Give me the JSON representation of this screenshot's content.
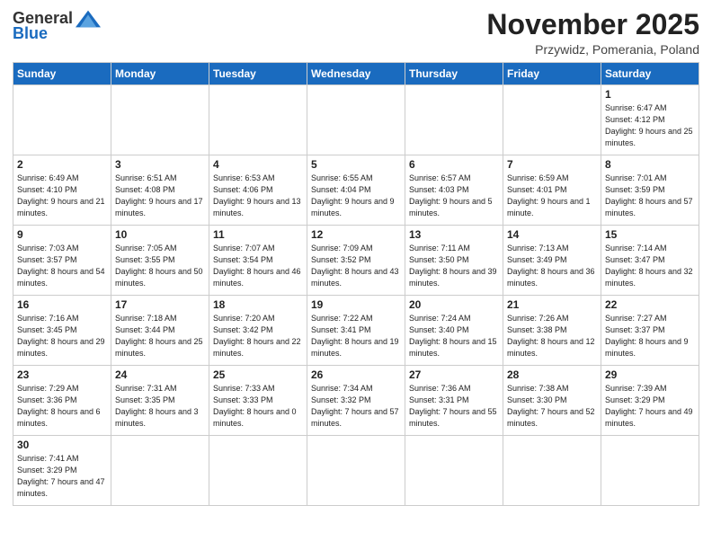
{
  "header": {
    "logo_general": "General",
    "logo_blue": "Blue",
    "month_title": "November 2025",
    "location": "Przywidz, Pomerania, Poland"
  },
  "weekdays": [
    "Sunday",
    "Monday",
    "Tuesday",
    "Wednesday",
    "Thursday",
    "Friday",
    "Saturday"
  ],
  "weeks": [
    [
      {
        "day": "",
        "info": ""
      },
      {
        "day": "",
        "info": ""
      },
      {
        "day": "",
        "info": ""
      },
      {
        "day": "",
        "info": ""
      },
      {
        "day": "",
        "info": ""
      },
      {
        "day": "",
        "info": ""
      },
      {
        "day": "1",
        "info": "Sunrise: 6:47 AM\nSunset: 4:12 PM\nDaylight: 9 hours\nand 25 minutes."
      }
    ],
    [
      {
        "day": "2",
        "info": "Sunrise: 6:49 AM\nSunset: 4:10 PM\nDaylight: 9 hours\nand 21 minutes."
      },
      {
        "day": "3",
        "info": "Sunrise: 6:51 AM\nSunset: 4:08 PM\nDaylight: 9 hours\nand 17 minutes."
      },
      {
        "day": "4",
        "info": "Sunrise: 6:53 AM\nSunset: 4:06 PM\nDaylight: 9 hours\nand 13 minutes."
      },
      {
        "day": "5",
        "info": "Sunrise: 6:55 AM\nSunset: 4:04 PM\nDaylight: 9 hours\nand 9 minutes."
      },
      {
        "day": "6",
        "info": "Sunrise: 6:57 AM\nSunset: 4:03 PM\nDaylight: 9 hours\nand 5 minutes."
      },
      {
        "day": "7",
        "info": "Sunrise: 6:59 AM\nSunset: 4:01 PM\nDaylight: 9 hours\nand 1 minute."
      },
      {
        "day": "8",
        "info": "Sunrise: 7:01 AM\nSunset: 3:59 PM\nDaylight: 8 hours\nand 57 minutes."
      }
    ],
    [
      {
        "day": "9",
        "info": "Sunrise: 7:03 AM\nSunset: 3:57 PM\nDaylight: 8 hours\nand 54 minutes."
      },
      {
        "day": "10",
        "info": "Sunrise: 7:05 AM\nSunset: 3:55 PM\nDaylight: 8 hours\nand 50 minutes."
      },
      {
        "day": "11",
        "info": "Sunrise: 7:07 AM\nSunset: 3:54 PM\nDaylight: 8 hours\nand 46 minutes."
      },
      {
        "day": "12",
        "info": "Sunrise: 7:09 AM\nSunset: 3:52 PM\nDaylight: 8 hours\nand 43 minutes."
      },
      {
        "day": "13",
        "info": "Sunrise: 7:11 AM\nSunset: 3:50 PM\nDaylight: 8 hours\nand 39 minutes."
      },
      {
        "day": "14",
        "info": "Sunrise: 7:13 AM\nSunset: 3:49 PM\nDaylight: 8 hours\nand 36 minutes."
      },
      {
        "day": "15",
        "info": "Sunrise: 7:14 AM\nSunset: 3:47 PM\nDaylight: 8 hours\nand 32 minutes."
      }
    ],
    [
      {
        "day": "16",
        "info": "Sunrise: 7:16 AM\nSunset: 3:45 PM\nDaylight: 8 hours\nand 29 minutes."
      },
      {
        "day": "17",
        "info": "Sunrise: 7:18 AM\nSunset: 3:44 PM\nDaylight: 8 hours\nand 25 minutes."
      },
      {
        "day": "18",
        "info": "Sunrise: 7:20 AM\nSunset: 3:42 PM\nDaylight: 8 hours\nand 22 minutes."
      },
      {
        "day": "19",
        "info": "Sunrise: 7:22 AM\nSunset: 3:41 PM\nDaylight: 8 hours\nand 19 minutes."
      },
      {
        "day": "20",
        "info": "Sunrise: 7:24 AM\nSunset: 3:40 PM\nDaylight: 8 hours\nand 15 minutes."
      },
      {
        "day": "21",
        "info": "Sunrise: 7:26 AM\nSunset: 3:38 PM\nDaylight: 8 hours\nand 12 minutes."
      },
      {
        "day": "22",
        "info": "Sunrise: 7:27 AM\nSunset: 3:37 PM\nDaylight: 8 hours\nand 9 minutes."
      }
    ],
    [
      {
        "day": "23",
        "info": "Sunrise: 7:29 AM\nSunset: 3:36 PM\nDaylight: 8 hours\nand 6 minutes."
      },
      {
        "day": "24",
        "info": "Sunrise: 7:31 AM\nSunset: 3:35 PM\nDaylight: 8 hours\nand 3 minutes."
      },
      {
        "day": "25",
        "info": "Sunrise: 7:33 AM\nSunset: 3:33 PM\nDaylight: 8 hours\nand 0 minutes."
      },
      {
        "day": "26",
        "info": "Sunrise: 7:34 AM\nSunset: 3:32 PM\nDaylight: 7 hours\nand 57 minutes."
      },
      {
        "day": "27",
        "info": "Sunrise: 7:36 AM\nSunset: 3:31 PM\nDaylight: 7 hours\nand 55 minutes."
      },
      {
        "day": "28",
        "info": "Sunrise: 7:38 AM\nSunset: 3:30 PM\nDaylight: 7 hours\nand 52 minutes."
      },
      {
        "day": "29",
        "info": "Sunrise: 7:39 AM\nSunset: 3:29 PM\nDaylight: 7 hours\nand 49 minutes."
      }
    ],
    [
      {
        "day": "30",
        "info": "Sunrise: 7:41 AM\nSunset: 3:29 PM\nDaylight: 7 hours\nand 47 minutes."
      },
      {
        "day": "",
        "info": ""
      },
      {
        "day": "",
        "info": ""
      },
      {
        "day": "",
        "info": ""
      },
      {
        "day": "",
        "info": ""
      },
      {
        "day": "",
        "info": ""
      },
      {
        "day": "",
        "info": ""
      }
    ]
  ]
}
